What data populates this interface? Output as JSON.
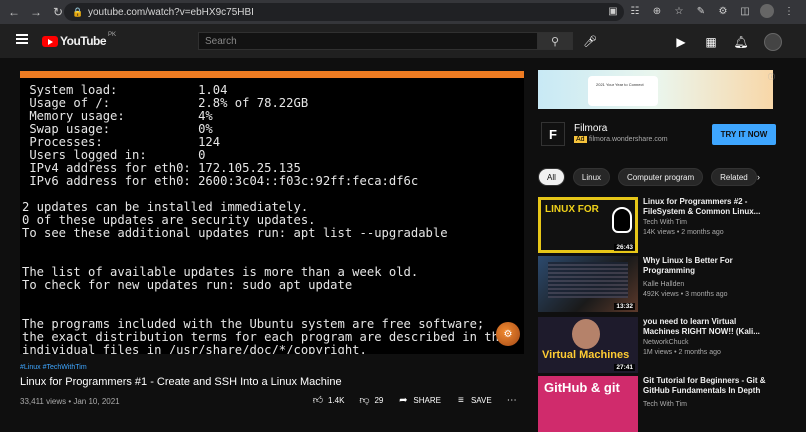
{
  "browser": {
    "url": "youtube.com/watch?v=ebHX9c75HBI"
  },
  "header": {
    "logo_text": "YouTube",
    "country_code": "PK",
    "search_placeholder": "Search"
  },
  "player": {
    "channel_badge": "",
    "terminal_text": " System load:           1.04\n Usage of /:            2.8% of 78.22GB\n Memory usage:          4%\n Swap usage:            0%\n Processes:             124\n Users logged in:       0\n IPv4 address for eth0: 172.105.25.135\n IPv6 address for eth0: 2600:3c04::f03c:92ff:feca:df6c\n\n2 updates can be installed immediately.\n0 of these updates are security updates.\nTo see these additional updates run: apt list --upgradable\n\n\nThe list of available updates is more than a week old.\nTo check for new updates run: sudo apt update\n\n\nThe programs included with the Ubuntu system are free software;\nthe exact distribution terms for each program are described in the\nindividual files in /usr/share/doc/*/copyright."
  },
  "video": {
    "hashtags": "#Linux #TechWithTim",
    "title": "Linux for Programmers #1 - Create and SSH Into a Linux Machine",
    "views_date": "33,411 views • Jan 10, 2021",
    "likes": "1.4K",
    "dislikes": "29",
    "share_label": "SHARE",
    "save_label": "SAVE"
  },
  "ad": {
    "banner_text": "2021 Your Year to Connect",
    "logo_letter": "F",
    "name": "Filmora",
    "tag": "Ad",
    "domain": "filmora.wondershare.com",
    "cta": "TRY IT NOW"
  },
  "chips": [
    "All",
    "Linux",
    "Computer program",
    "Related"
  ],
  "recommendations": [
    {
      "title": "Linux for Programmers #2 - FileSystem & Common Linux...",
      "channel": "Tech With Tim",
      "meta": "14K views • 2 months ago",
      "duration": "26:43",
      "thumb_text": "LINUX FOR"
    },
    {
      "title": "Why Linux Is Better For Programming",
      "channel": "Kalle Hallden",
      "meta": "492K views • 3 months ago",
      "duration": "13:32",
      "thumb_text": ""
    },
    {
      "title": "you need to learn Virtual Machines RIGHT NOW!! (Kali...",
      "channel": "NetworkChuck",
      "meta": "1M views • 2 months ago",
      "duration": "27:41",
      "thumb_text": "Virtual Machines"
    },
    {
      "title": "Git Tutorial for Beginners - Git & GitHub Fundamentals In Depth",
      "channel": "Tech With Tim",
      "meta": "",
      "duration": "",
      "thumb_text": "GitHub & git"
    }
  ],
  "colors": {
    "accent_blue": "#3ea6ff",
    "youtube_red": "#ff0000",
    "player_bar": "#ee7b22"
  }
}
